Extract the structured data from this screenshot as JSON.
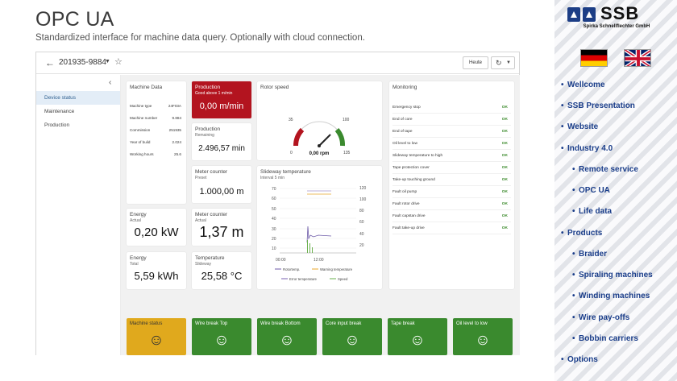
{
  "hero": {
    "title": "OPC UA",
    "subtitle": "Standardized interface for machine data query. Optionally with cloud connection."
  },
  "app": {
    "topbar": {
      "machine_id": "201935-9884",
      "today_label": "Heute",
      "refresh_icon": "refresh-icon"
    },
    "sidebar": {
      "items": [
        {
          "label": "Device status",
          "active": true
        },
        {
          "label": "Maintenance",
          "active": false
        },
        {
          "label": "Production",
          "active": false
        }
      ]
    },
    "machine_data": {
      "title": "Machine Data",
      "rows": [
        {
          "key": "Machine type",
          "value": "24F03A"
        },
        {
          "key": "Machine number",
          "value": "9.884"
        },
        {
          "key": "Commission",
          "value": "251935"
        },
        {
          "key": "Year of build",
          "value": "2.024"
        },
        {
          "key": "Working hours",
          "value": "25.6"
        }
      ]
    },
    "production_alert": {
      "title": "Production",
      "sub": "Good above 1 m/min",
      "value": "0,00 m/min"
    },
    "production_remaining": {
      "title": "Production",
      "sub": "Remaining",
      "value": "2.496,57 min"
    },
    "meter_preset": {
      "title": "Meter counter",
      "sub": "Preset",
      "value": "1.000,00 m"
    },
    "meter_actual": {
      "title": "Meter counter",
      "sub": "Actual",
      "value": "1,37 m"
    },
    "energy_actual": {
      "title": "Energy",
      "sub": "Actual",
      "value": "0,20 kW"
    },
    "energy_total": {
      "title": "Energy",
      "sub": "Total",
      "value": "5,59 kWh"
    },
    "temperature": {
      "title": "Temperature",
      "sub": "Slideway",
      "value": "25,58 °C"
    },
    "rotor_speed": {
      "title": "Rotor speed",
      "ticks": [
        "0",
        "35",
        "100",
        "135"
      ],
      "value": "0,00 rpm",
      "value_number": 0,
      "min": 0,
      "max": 135
    },
    "slideway_temp": {
      "title": "Slideway temperature",
      "sub": "Interval 5 min",
      "y_left": [
        "70",
        "60",
        "50",
        "40",
        "30",
        "20",
        "10"
      ],
      "y_right": [
        "120",
        "100",
        "80",
        "60",
        "40",
        "20"
      ],
      "x_ticks": [
        "00:00",
        "12:00"
      ],
      "legend": [
        "Rotortemp.",
        "Warning temperature",
        "Error temperature",
        "Speed"
      ],
      "colors": {
        "rotor": "#6c5aa8",
        "warning": "#e8a72a",
        "error": "#7a62b0",
        "speed": "#6ab04c"
      }
    },
    "monitoring": {
      "title": "Monitoring",
      "rows": [
        {
          "label": "Emergency stop",
          "status": "OK"
        },
        {
          "label": "End of core",
          "status": "OK"
        },
        {
          "label": "End of tape",
          "status": "OK"
        },
        {
          "label": "Oil level to low",
          "status": "OK"
        },
        {
          "label": "Slideway temperature to high",
          "status": "OK"
        },
        {
          "label": "Tape protection cover",
          "status": "OK"
        },
        {
          "label": "Take-up touching ground",
          "status": "OK"
        },
        {
          "label": "Fault oil pump",
          "status": "OK"
        },
        {
          "label": "Fault rotor drive",
          "status": "OK"
        },
        {
          "label": "Fault capstan drive",
          "status": "OK"
        },
        {
          "label": "Fault take-up drive",
          "status": "OK"
        }
      ]
    },
    "status_tiles": [
      {
        "label": "Machine status",
        "state": "warning",
        "icon": "smiley-icon"
      },
      {
        "label": "Wire break Top",
        "state": "ok",
        "icon": "smiley-icon"
      },
      {
        "label": "Wire break Bottom",
        "state": "ok",
        "icon": "smiley-icon"
      },
      {
        "label": "Core input break",
        "state": "ok",
        "icon": "smiley-icon"
      },
      {
        "label": "Tape break",
        "state": "ok",
        "icon": "smiley-icon"
      },
      {
        "label": "Oil level to low",
        "state": "ok",
        "icon": "smiley-icon"
      }
    ]
  },
  "brand": {
    "logo_text": "SSB",
    "logo_sub": "Spirka Schnellflechter GmbH"
  },
  "site_nav": [
    {
      "label": "Wellcome",
      "level": 0
    },
    {
      "label": "SSB Presentation",
      "level": 0
    },
    {
      "label": "Website",
      "level": 0
    },
    {
      "label": "Industry 4.0",
      "level": 0
    },
    {
      "label": "Remote service",
      "level": 1
    },
    {
      "label": "OPC UA",
      "level": 1
    },
    {
      "label": "Life data",
      "level": 1
    },
    {
      "label": "Products",
      "level": 0
    },
    {
      "label": "Braider",
      "level": 1
    },
    {
      "label": "Spiraling machines",
      "level": 1
    },
    {
      "label": "Winding machines",
      "level": 1
    },
    {
      "label": "Wire pay-offs",
      "level": 1
    },
    {
      "label": "Bobbin carriers",
      "level": 1
    },
    {
      "label": "Options",
      "level": 0
    }
  ]
}
